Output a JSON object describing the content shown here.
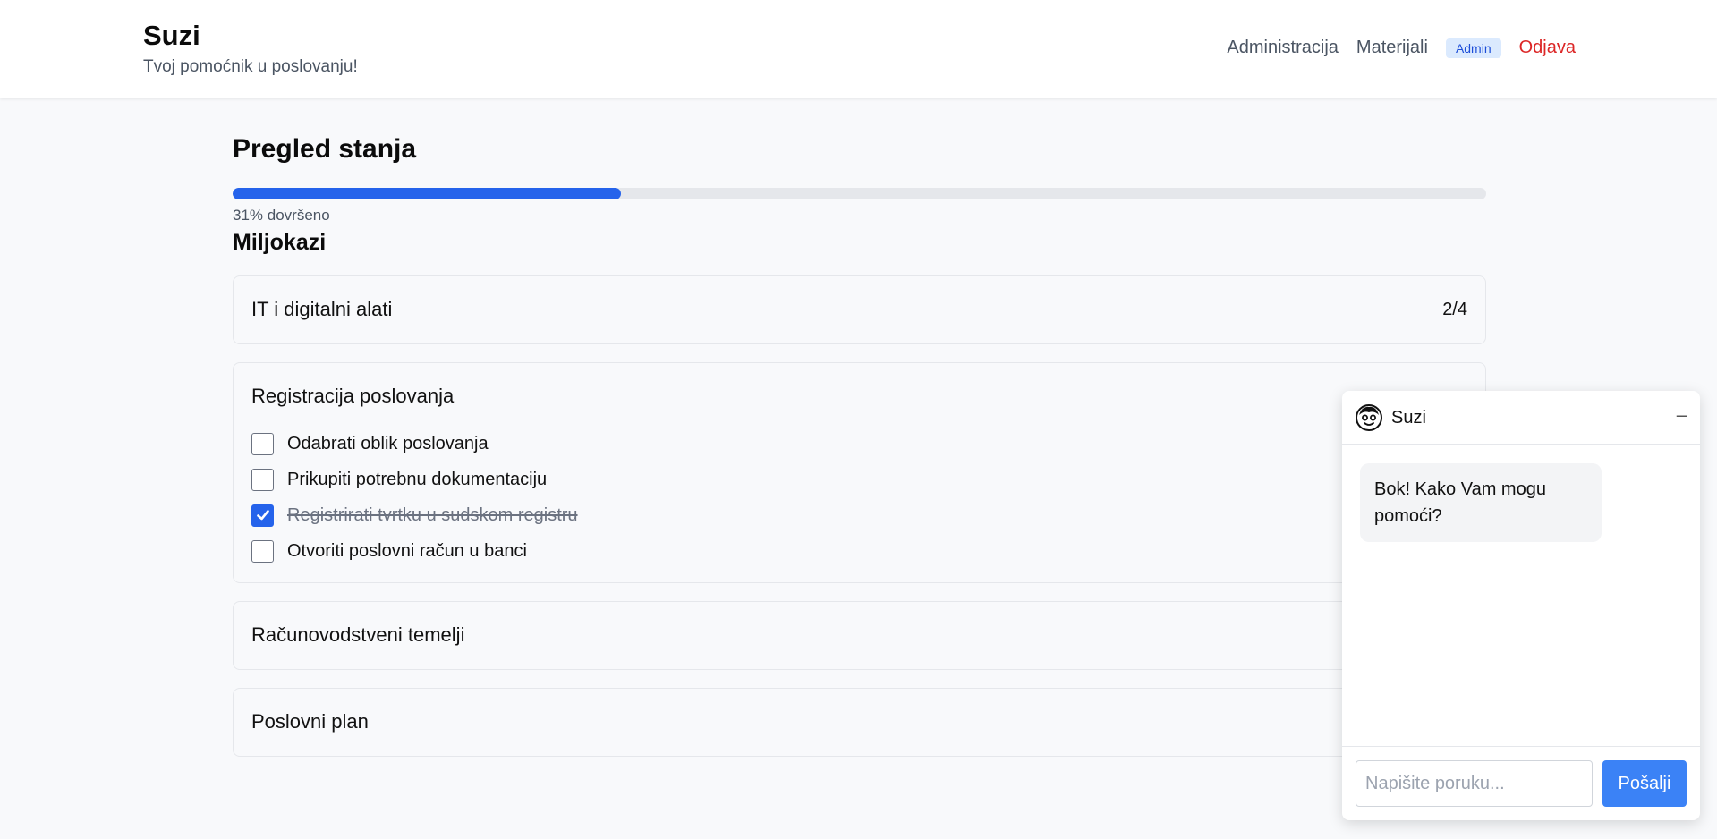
{
  "header": {
    "brand_title": "Suzi",
    "brand_subtitle": "Tvoj pomoćnik u poslovanju!",
    "nav": {
      "administration": "Administracija",
      "materials": "Materijali",
      "admin_badge": "Admin",
      "logout": "Odjava"
    }
  },
  "main": {
    "title": "Pregled stanja",
    "progress": {
      "percent": 31,
      "label": "31% dovršeno"
    },
    "milestones_title": "Miljokazi",
    "milestones": [
      {
        "title": "IT i digitalni alati",
        "count": "2/4"
      },
      {
        "title": "Registracija poslovanja",
        "tasks": [
          {
            "label": "Odabrati oblik poslovanja",
            "done": false
          },
          {
            "label": "Prikupiti potrebnu dokumentaciju",
            "done": false
          },
          {
            "label": "Registrirati tvrtku u sudskom registru",
            "done": true
          },
          {
            "label": "Otvoriti poslovni račun u banci",
            "done": false
          }
        ]
      },
      {
        "title": "Računovodstveni temelji"
      },
      {
        "title": "Poslovni plan"
      }
    ]
  },
  "chat": {
    "name": "Suzi",
    "minimize_icon": "minimize-icon",
    "minimize_glyph": "–",
    "messages": [
      {
        "from": "bot",
        "text": "Bok! Kako Vam mogu pomoći?"
      }
    ],
    "input_placeholder": "Napišite poruku...",
    "send_label": "Pošalji"
  },
  "colors": {
    "accent": "#2563eb",
    "send_button": "#3b82f6",
    "logout": "#dc2626",
    "badge_bg": "#dbeafe"
  }
}
